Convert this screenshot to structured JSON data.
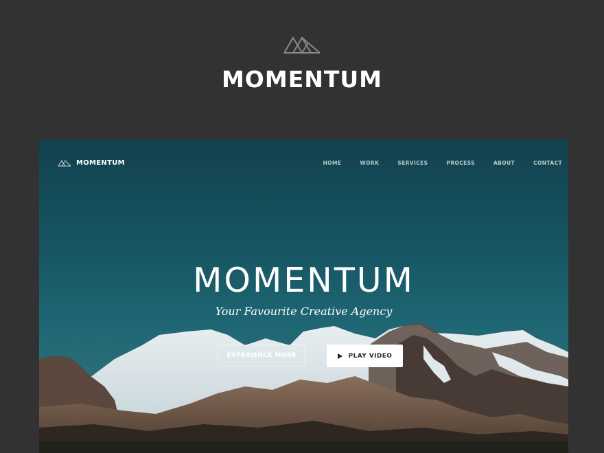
{
  "header": {
    "logo_icon": "mountain-logo-icon",
    "title": "MOMENTUM"
  },
  "preview": {
    "logo_icon": "mountain-logo-icon",
    "brand": "MOMENTUM",
    "nav": {
      "items": [
        "HOME",
        "WORK",
        "SERVICES",
        "PROCESS",
        "ABOUT",
        "CONTACT"
      ]
    },
    "hero": {
      "title": "MOMENTUM",
      "subtitle": "Your Favourite Creative Agency",
      "experience_button": "EXPERIENCE MORE",
      "play_button": "PLAY VIDEO",
      "play_icon": "play-icon"
    }
  },
  "colors": {
    "background": "#323232",
    "sky_top": "#12414d",
    "sky_bottom": "#2a6d79",
    "text": "#ffffff",
    "nav_text": "#b9c9cd"
  }
}
